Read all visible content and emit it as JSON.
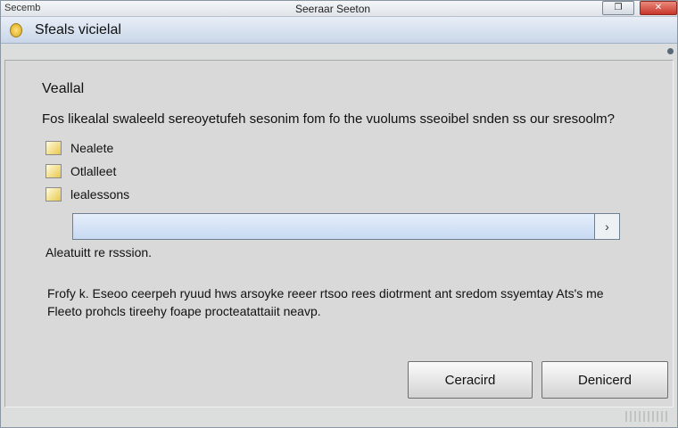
{
  "titlebar": {
    "app_name": "Secemb",
    "title": "Seeraar Seeton",
    "max_icon": "restore-icon",
    "close_icon": "close-icon"
  },
  "header": {
    "title": "Sfeals vicielal",
    "icon": "shield-icon"
  },
  "content": {
    "section_title": "Veallal",
    "question": "Fos likealal swaleeld sereoyetufeh sesonim fom fo the vuolums sseoibel snden ss our sresoolm?",
    "options": [
      {
        "label": "Nealete",
        "checked": true
      },
      {
        "label": "Otlalleet",
        "checked": true
      },
      {
        "label": "lealessons",
        "checked": true
      }
    ],
    "input": {
      "value": "",
      "placeholder": ""
    },
    "field_label": "Aleatuitt re rsssion.",
    "description": "Frofy k. Eseoo ceerpeh ryuud hws arsoyke reeer rtsoo rees diotrment ant sredom ssyemtay Ats's me Fleeto prohcls tireehy foape procteatattaiit neavp."
  },
  "buttons": {
    "primary": "Ceracird",
    "secondary": "Denicerd"
  },
  "colors": {
    "accent": "#c8d9f1",
    "close": "#c8352a",
    "checkbox": "#e7c84a"
  }
}
